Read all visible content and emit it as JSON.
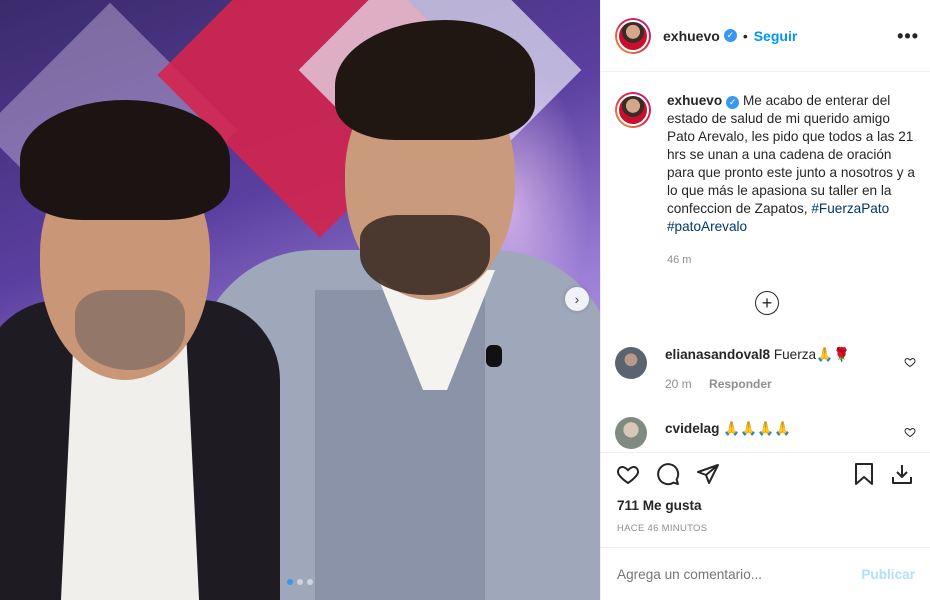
{
  "header": {
    "username": "exhuevo",
    "separator": "•",
    "follow_label": "Seguir",
    "more_label": "•••"
  },
  "caption": {
    "username": "exhuevo",
    "text": "Me acabo de enterar del estado de salud de mi querido amigo Pato Arevalo, les pido que todos a las 21 hrs se unan a una cadena de oración para que pronto este junto a nosotros y a lo que más le apasiona su taller en la confeccion de Zapatos,",
    "hashtags": [
      "#FuerzaPato",
      "#patoArevalo"
    ],
    "time": "46 m"
  },
  "load_more_label": "+",
  "comments": [
    {
      "username": "elianasandoval8",
      "text": "Fuerza🙏🌹",
      "time": "20 m",
      "reply_label": "Responder"
    },
    {
      "username": "cvidelag",
      "text": "🙏🙏🙏🙏",
      "time": "",
      "reply_label": ""
    }
  ],
  "actions": {
    "likes": "711 Me gusta",
    "posted": "HACE 46 MINUTOS",
    "comment_placeholder": "Agrega un comentario...",
    "publish_label": "Publicar"
  },
  "carousel": {
    "total": 3,
    "active": 0,
    "next_label": "›"
  },
  "colors": {
    "accent": "#0095f6",
    "verified": "#3897f0",
    "hashtag": "#00376b",
    "muted": "#8e8e8e"
  }
}
